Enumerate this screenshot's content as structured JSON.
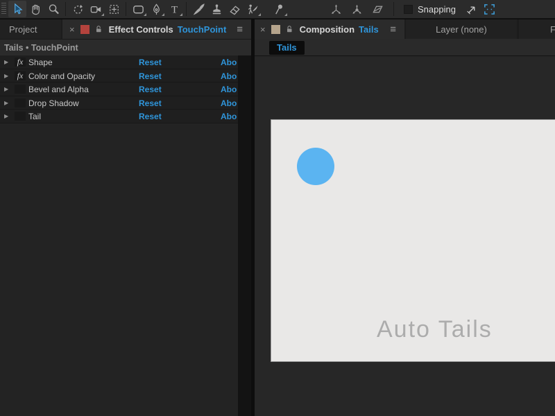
{
  "icons": {
    "disclosure": "▶",
    "close": "×",
    "menu": "≡"
  },
  "toolbar": {
    "snapping_label": "Snapping",
    "snapping_checked": false,
    "tools": [
      "selection",
      "hand",
      "zoom",
      "rotation",
      "camera",
      "pan-behind",
      "shape",
      "pen",
      "type",
      "brush",
      "stamp",
      "eraser",
      "roto-brush",
      "puppet-pin",
      "axis-local",
      "axis-world",
      "axis-view",
      "snap-to",
      "region-of-interest"
    ]
  },
  "left_panel": {
    "tab_project": "Project",
    "tab_active": {
      "title": "Effect Controls",
      "target": "TouchPoint"
    },
    "header": "Tails • TouchPoint",
    "effects": [
      {
        "name": "Shape",
        "fx": "fx",
        "reset": "Reset",
        "about": "Abo"
      },
      {
        "name": "Color and Opacity",
        "fx": "fx",
        "reset": "Reset",
        "about": "Abo"
      },
      {
        "name": "Bevel and Alpha",
        "fx": "",
        "reset": "Reset",
        "about": "Abo"
      },
      {
        "name": "Drop Shadow",
        "fx": "",
        "reset": "Reset",
        "about": "Abo"
      },
      {
        "name": "Tail",
        "fx": "",
        "reset": "Reset",
        "about": "Abo"
      }
    ]
  },
  "right_panel": {
    "tab_active": {
      "title": "Composition",
      "target": "Tails"
    },
    "tab_layer": "Layer (none)",
    "tab_partial": "F",
    "breadcrumb": "Tails",
    "canvas_text": "Auto Tails"
  },
  "colors": {
    "accent_blue": "#2f95da",
    "swatch_red": "#b4433d",
    "swatch_tan": "#b5a48c",
    "circle_blue": "#5bb4f1",
    "canvas_bg": "#e9e8e7",
    "selection_tool_blue": "#59ace4"
  }
}
